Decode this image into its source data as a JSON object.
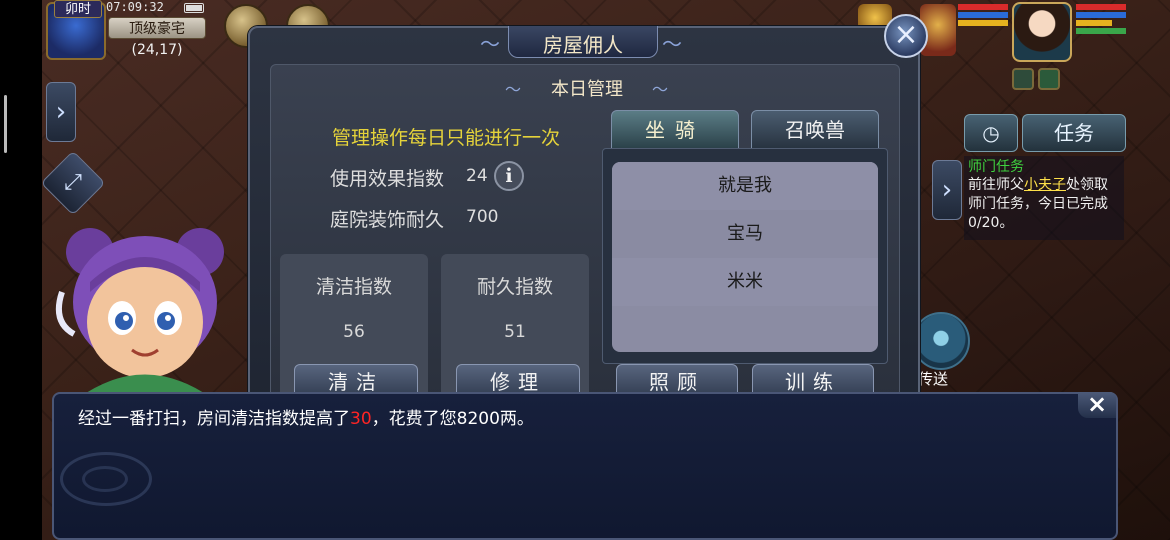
{
  "hud": {
    "shichen": "卯时",
    "clock": "07:09:32",
    "place": "顶级豪宅",
    "coords": "(24,17)"
  },
  "dialog": {
    "title": "房屋佣人",
    "section_title": "本日管理",
    "notice": "管理操作每日只能进行一次",
    "stats": [
      {
        "label": "使用效果指数",
        "value": "24"
      },
      {
        "label": "庭院装饰耐久",
        "value": "700"
      }
    ],
    "info_icon": "i",
    "cards": [
      {
        "label": "清洁指数",
        "value": "56",
        "button": "清洁"
      },
      {
        "label": "耐久指数",
        "value": "51",
        "button": "修理"
      }
    ],
    "tabs": [
      "坐骑",
      "召唤兽"
    ],
    "list": [
      "就是我",
      "宝马",
      "米米"
    ],
    "actions": [
      "照顾",
      "训练"
    ],
    "close_icon": "×"
  },
  "quest": {
    "task_button": "任务",
    "title": "师门任务",
    "text_pre": "前往师父",
    "npc": "小夫子",
    "text_post": "处领取师门任务，今日已完成0/20。"
  },
  "teleport": "传送",
  "message": {
    "pre": "经过一番打扫，房间清洁指数提高了",
    "amount": "30",
    "post": "，花费了您8200两。",
    "highlight_color": "#ff2424"
  },
  "icons": {
    "close": "close-icon",
    "info": "info-icon",
    "clock": "timer-icon",
    "expand": "expand-arrows-icon",
    "side_arrow": "chevron-right-icon"
  }
}
